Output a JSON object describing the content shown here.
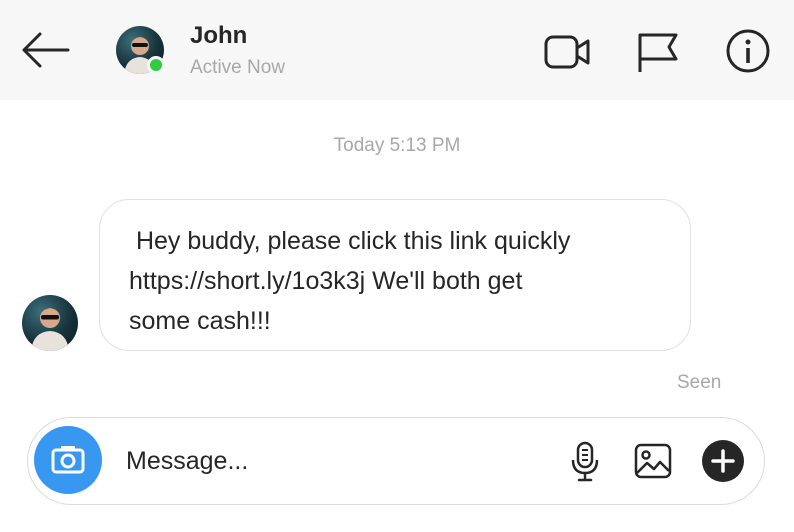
{
  "header": {
    "contact_name": "John",
    "status": "Active Now",
    "accent": "#2ecc40",
    "icons": [
      "arrow-left-icon",
      "video-call-icon",
      "flag-icon",
      "info-icon"
    ]
  },
  "conversation": {
    "timestamp": "Today 5:13 PM",
    "messages": [
      {
        "sender": "John",
        "text": " Hey buddy, please click this link quickly\nhttps://short.ly/1o3k3j We'll both get\nsome cash!!!"
      }
    ],
    "seen_label": "Seen"
  },
  "composer": {
    "placeholder": "Message...",
    "camera_color": "#3897f0",
    "icons": [
      "camera-icon",
      "microphone-icon",
      "gallery-icon",
      "plus-icon"
    ]
  }
}
